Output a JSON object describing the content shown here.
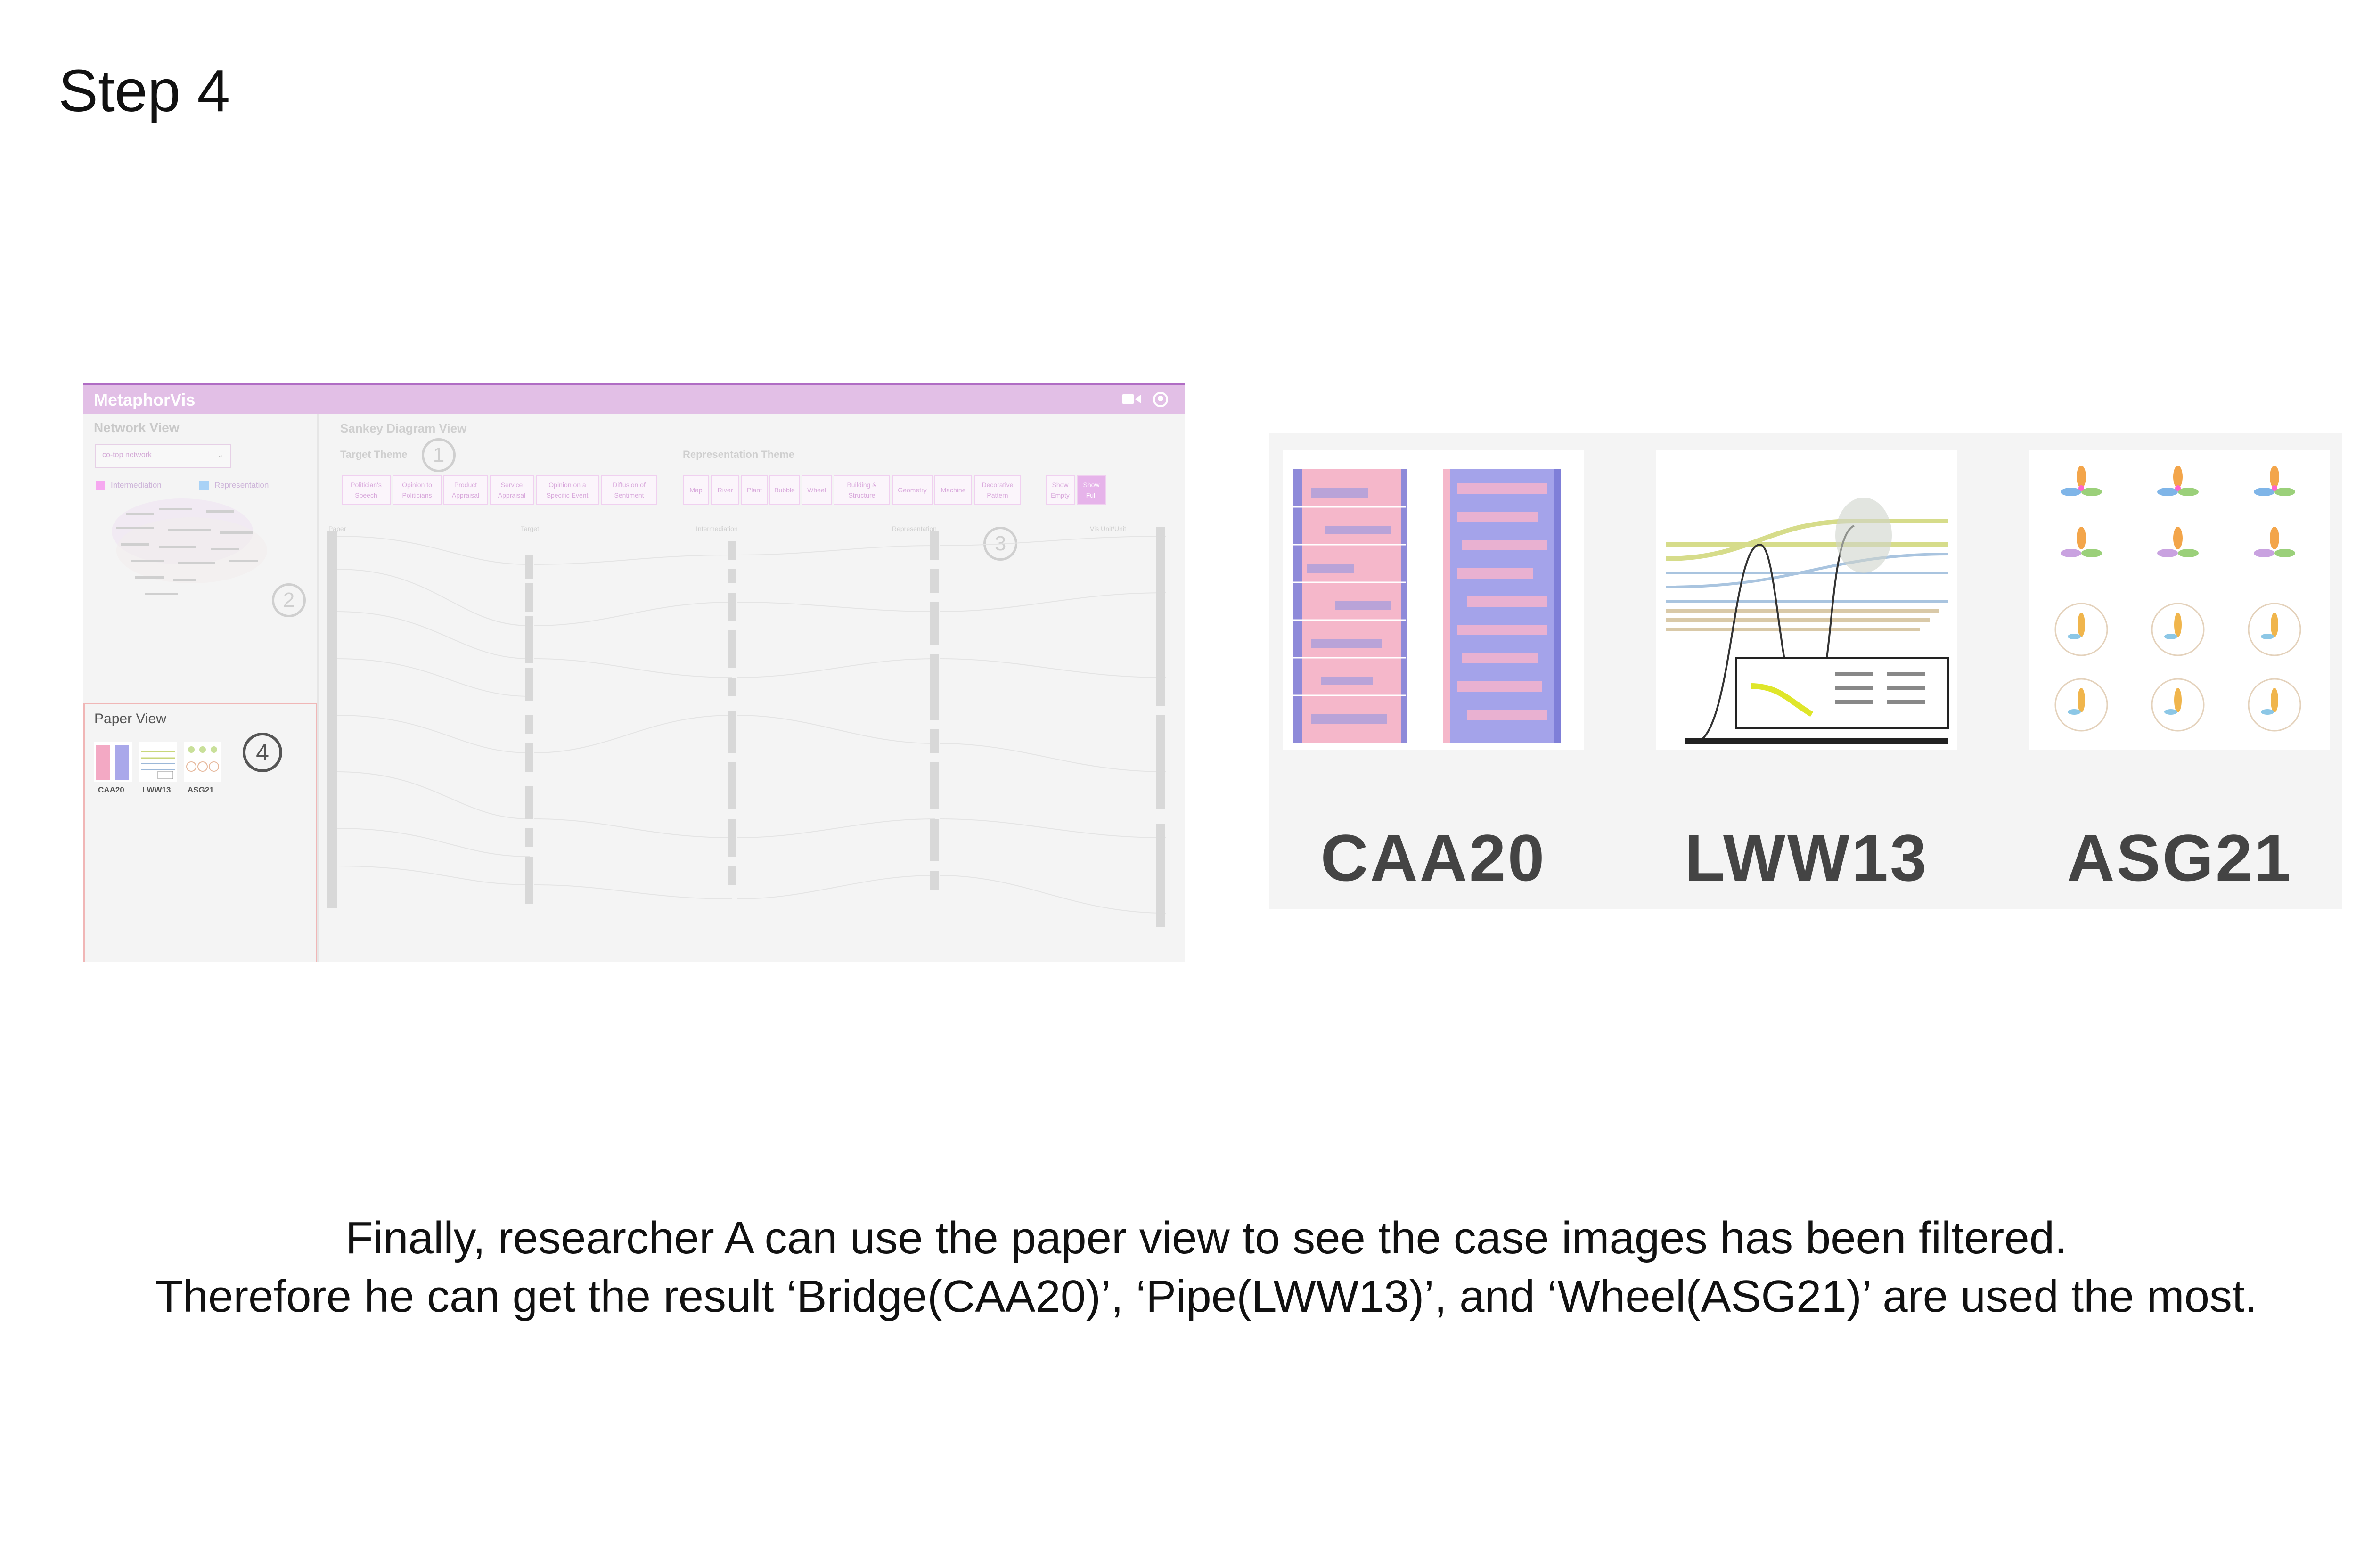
{
  "step_title": "Step 4",
  "app": {
    "title": "MetaphorVis",
    "network_view": {
      "label": "Network View",
      "dropdown_value": "co-top network",
      "legend": [
        {
          "label": "Intermediation",
          "color": "#f6a8f0"
        },
        {
          "label": "Representation",
          "color": "#a9d2f6"
        }
      ],
      "marker": "2"
    },
    "paper_view": {
      "label": "Paper View",
      "papers": [
        "CAA20",
        "LWW13",
        "ASG21"
      ],
      "marker": "4"
    },
    "sankey_view": {
      "label": "Sankey Diagram View",
      "target_theme_label": "Target Theme",
      "target_marker": "1",
      "representation_theme_label": "Representation Theme",
      "representation_marker": "3",
      "target_buttons": [
        "Politician's Speech",
        "Opinion to Politicians",
        "Product Appraisal",
        "Service Appraisal",
        "Opinion on a Specific Event",
        "Diffusion of Sentiment"
      ],
      "representation_buttons": [
        "Map",
        "River",
        "Plant",
        "Bubble",
        "Wheel",
        "Building & Structure",
        "Geometry",
        "Machine",
        "Decorative Pattern"
      ],
      "show_buttons": [
        "Show Empty",
        "Show Full"
      ],
      "columns": [
        "Paper",
        "Target",
        "Intermediation",
        "Representation",
        "Vis Unit/Unit"
      ]
    }
  },
  "zoom": {
    "cases": [
      "CAA20",
      "LWW13",
      "ASG21"
    ]
  },
  "caption": {
    "line1": "Finally, researcher A can use the paper view to see the case images has been filtered.",
    "line2": "Therefore he can get the result ‘Bridge(CAA20)’, ‘Pipe(LWW13)’, and ‘Wheel(ASG21)’ are used the most."
  }
}
